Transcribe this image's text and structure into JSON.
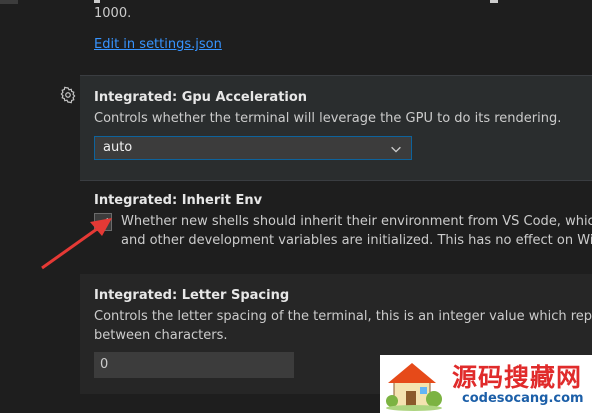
{
  "top_fragment": "1000.",
  "edit_link": "Edit in settings.json",
  "gpu_setting": {
    "category": "Integrated: ",
    "name": "Gpu Acceleration",
    "description": "Controls whether the terminal will leverage the GPU to do its rendering.",
    "selected_value": "auto"
  },
  "inherit_env_setting": {
    "category": "Integrated: ",
    "name": "Inherit Env",
    "checked": true,
    "description_line1": "Whether new shells should inherit their environment from VS Code, which may sou",
    "description_line2": "and other development variables are initialized. This has no effect on Windows."
  },
  "letter_spacing_setting": {
    "category": "Integrated: ",
    "name": "Letter Spacing",
    "description_line1": "Controls the letter spacing of the terminal, this is an integer value which represents the",
    "description_line2": "between characters.",
    "value": "0"
  },
  "watermark": {
    "chinese_text": "源码搜藏网",
    "url": "codesocang.com"
  },
  "colors": {
    "background": "#1e1e1e",
    "focused_row": "#2a2d2e",
    "link": "#3794ff",
    "select_border": "#0e639c",
    "arrow": "#e53935",
    "watermark_text": "#e02b2b",
    "watermark_url": "#1c5fa8"
  }
}
